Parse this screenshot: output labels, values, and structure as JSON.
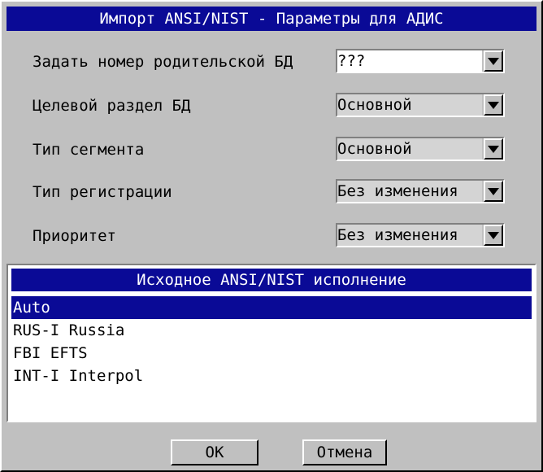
{
  "window": {
    "title": "Импорт ANSI/NIST - Параметры для АДИС"
  },
  "fields": [
    {
      "label": "Задать номер родительской БД",
      "value": "???"
    },
    {
      "label": "Целевой раздел БД",
      "value": "Основной"
    },
    {
      "label": "Тип сегмента",
      "value": "Основной"
    },
    {
      "label": "Тип регистрации",
      "value": "Без изменения"
    },
    {
      "label": "Приоритет",
      "value": "Без изменения"
    }
  ],
  "list": {
    "header": "Исходное ANSI/NIST исполнение",
    "items": [
      "Auto",
      "RUS-I Russia",
      "FBI EFTS",
      "INT-I Interpol"
    ],
    "selected": "Auto"
  },
  "buttons": {
    "ok": "OK",
    "cancel": "Отмена"
  },
  "icons": {
    "dropdown": "chevron-down-icon"
  },
  "colors": {
    "titlebar": "#0a0a96",
    "selection": "#0a0a96",
    "background": "#c0c0c0"
  }
}
